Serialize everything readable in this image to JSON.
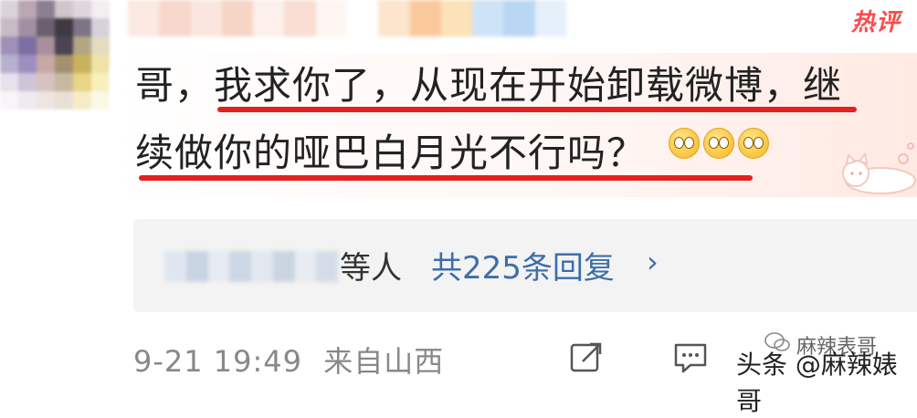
{
  "badge": {
    "label": "热评"
  },
  "comment": {
    "line1": "哥，我求你了，从现在开始卸载微博，继",
    "line2": "续做你的哑巴白月光不行吗？",
    "emoji_count": 3,
    "emoji_icon": "pleading-face-icon",
    "highlight_color": "#e4211e"
  },
  "reply": {
    "suffix": "等人",
    "count_text": "共225条回复",
    "chevron": "›",
    "link_color": "#3e6ea8"
  },
  "meta": {
    "timestamp": "9-21 19:49",
    "source": "来自山西"
  },
  "actions": [
    {
      "icon": "share-icon"
    },
    {
      "icon": "comment-icon"
    }
  ],
  "watermark": {
    "wechat": "麻辣表哥",
    "toutiao": "头条 @麻辣婊哥"
  }
}
